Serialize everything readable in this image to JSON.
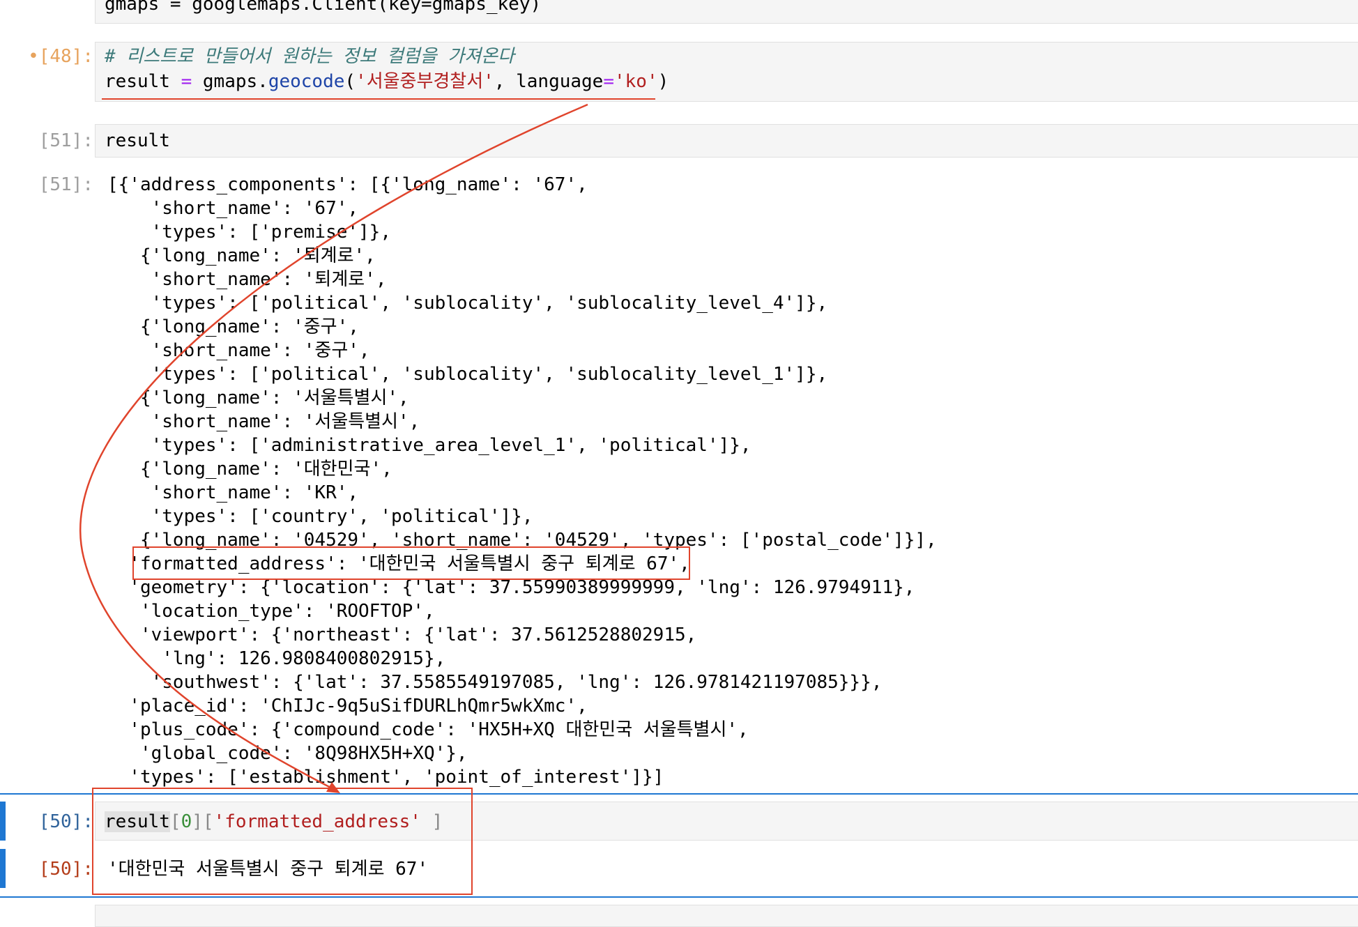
{
  "cells": {
    "top": {
      "code": "gmaps = googlemaps.Client(key=gmaps_key)"
    },
    "c48": {
      "prompt": "•[48]:",
      "comment": "# 리스트로 만들어서 원하는 정보 컬럼을 가져온다",
      "code_var": "result",
      "code_eq": " = ",
      "code_obj": "gmaps.",
      "code_fn": "geocode",
      "code_open": "(",
      "code_str1": "'서울중부경찰서'",
      "code_mid": ", language",
      "code_eq2": "=",
      "code_str2": "'ko'",
      "code_close": ")"
    },
    "c51_in": {
      "prompt": "[51]:",
      "code": "result"
    },
    "c51_out": {
      "prompt": "[51]:",
      "lines": [
        "[{'address_components': [{'long_name': '67',",
        "    'short_name': '67',",
        "    'types': ['premise']},",
        "   {'long_name': '퇴계로',",
        "    'short_name': '퇴계로',",
        "    'types': ['political', 'sublocality', 'sublocality_level_4']},",
        "   {'long_name': '중구',",
        "    'short_name': '중구',",
        "    'types': ['political', 'sublocality', 'sublocality_level_1']},",
        "   {'long_name': '서울특별시',",
        "    'short_name': '서울특별시',",
        "    'types': ['administrative_area_level_1', 'political']},",
        "   {'long_name': '대한민국',",
        "    'short_name': 'KR',",
        "    'types': ['country', 'political']},",
        "   {'long_name': '04529', 'short_name': '04529', 'types': ['postal_code']}],",
        "  'formatted_address': '대한민국 서울특별시 중구 퇴계로 67',",
        "  'geometry': {'location': {'lat': 37.55990389999999, 'lng': 126.9794911},",
        "   'location_type': 'ROOFTOP',",
        "   'viewport': {'northeast': {'lat': 37.5612528802915,",
        "     'lng': 126.9808400802915},",
        "    'southwest': {'lat': 37.5585549197085, 'lng': 126.9781421197085}}},",
        "  'place_id': 'ChIJc-9q5uSifDURLhQmr5wkXmc',",
        "  'plus_code': {'compound_code': 'HX5H+XQ 대한민국 서울특별시',",
        "   'global_code': '8Q98HX5H+XQ'},",
        "  'types': ['establishment', 'point_of_interest']}]"
      ]
    },
    "c50_in": {
      "prompt": "[50]:",
      "code_var": "result",
      "code_b1": "[",
      "code_num": "0",
      "code_b2": "][",
      "code_str": "'formatted_address'",
      "code_b3": " ]"
    },
    "c50_out": {
      "prompt": "[50]:",
      "value": "'대한민국 서울특별시 중구 퇴계로 67'"
    }
  },
  "colors": {
    "annotation": "#e0442c",
    "selection": "#1e77d2",
    "comment": "#3d7a7a",
    "string": "#b11f1f",
    "function": "#1f45a8"
  }
}
